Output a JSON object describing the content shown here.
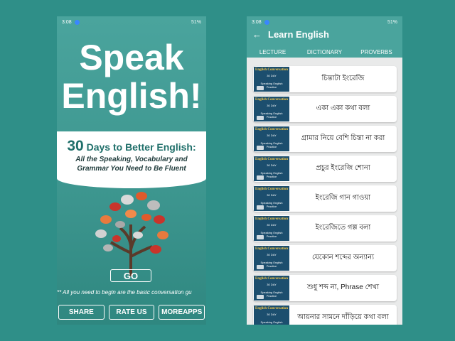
{
  "status": {
    "time": "3:08",
    "indicators": "51% "
  },
  "left": {
    "title_line1": "Speak",
    "title_line2": "English!",
    "days_number": "30",
    "days_text": " Days to Better English:",
    "sub_line1": "All the Speaking, Vocabulary and",
    "sub_line2": "Grammar You Need to Be Fluent",
    "go_label": "GO",
    "note": "** All you need to begin are the basic conversation gu",
    "buttons": [
      "SHARE",
      "RATE US",
      "MOREAPPS"
    ]
  },
  "right": {
    "title": "Learn English",
    "tabs": [
      "LECTURE",
      "DICTIONARY",
      "PROVERBS"
    ],
    "thumb": {
      "title": "English Conversation",
      "days": "30 DAY",
      "caption": "Speaking English Practice"
    },
    "items": [
      "চিন্তাটা ইংরেজি",
      "একা একা কথা বলা",
      "গ্রামার নিয়ে বেশি চিন্তা না করা",
      "প্রচুর ইংরেজি শোনা",
      "ইংরেজি গান গাওয়া",
      "ইংরেজিতে গল্প বলা",
      "যেকোন শব্দের অন্যান্য",
      "শুধু শব্দ না, Phrase শেখা",
      "আয়নার সামনে দাঁড়িয়ে কথা বলা"
    ]
  }
}
